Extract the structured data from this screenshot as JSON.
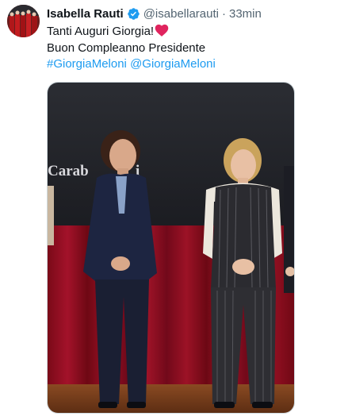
{
  "tweet": {
    "author": {
      "display_name": "Isabella Rauti",
      "handle": "@isabellarauti",
      "verified": true,
      "avatar_icon": "avatar-photo"
    },
    "separator": "·",
    "timestamp": "33min",
    "text": {
      "line1": "Tanti Auguri Giorgia!",
      "line2": "Buon Compleanno Presidente",
      "hashtag": "#GiorgiaMeloni",
      "mention": "@GiorgiaMeloni"
    },
    "media": {
      "backdrop_text": "Carab",
      "backdrop_text_tail": "i"
    },
    "colors": {
      "link": "#1d9bf0",
      "verified_badge": "#1d9bf0",
      "heart": "#e0245e",
      "secondary_text": "#536471"
    }
  }
}
